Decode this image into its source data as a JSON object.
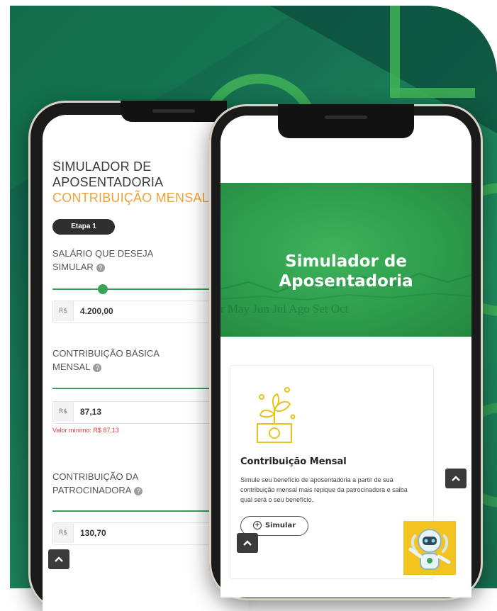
{
  "colors": {
    "background_dark": "#0d5a46",
    "background_mid": "#1f8d5e",
    "accent_green": "#41b357",
    "hero_green": "#2c9a4b",
    "subtitle_orange": "#f0a23a",
    "error_red": "#e53b3b",
    "robot_yellow": "#f3c41f"
  },
  "left_phone": {
    "title_line1": "SIMULADOR DE",
    "title_line2": "APOSENTADORIA",
    "subtitle": "CONTRIBUIÇÃO MENSAL",
    "step_badge": "Etapa 1",
    "fields": [
      {
        "label_line1": "SALÁRIO QUE DESEJA",
        "label_line2": "SIMULAR",
        "currency": "R$",
        "value": "4.200,00"
      },
      {
        "label_line1": "CONTRIBUIÇÃO BÁSICA",
        "label_line2": "MENSAL",
        "currency": "R$",
        "value": "87,13",
        "error": "Valor mínimo: R$ 87,13"
      },
      {
        "label_line1": "CONTRIBUIÇÃO DA",
        "label_line2": "PATROCINADORA",
        "currency": "R$",
        "value": "130,70"
      }
    ],
    "help_icon": "help-circle-icon",
    "scroll_top_icon": "chevron-up-icon"
  },
  "right_phone": {
    "hero_title_line1": "Simulador de",
    "hero_title_line2": "Aposentadoria",
    "hero_bg_text": "r May Jun Jul Ago Set Oct",
    "card": {
      "icon": "plant-money-icon",
      "title": "Contribuição Mensal",
      "description": "Simule seu benefício de aposentadoria a partir de sua contribuição mensal mais repique da patrocinadora e saiba qual será o seu benefício.",
      "button_icon": "plus-circle-icon",
      "button_label": "Simular"
    },
    "scroll_top_icon": "chevron-up-icon",
    "assistant_icon": "robot-assistant-icon"
  }
}
